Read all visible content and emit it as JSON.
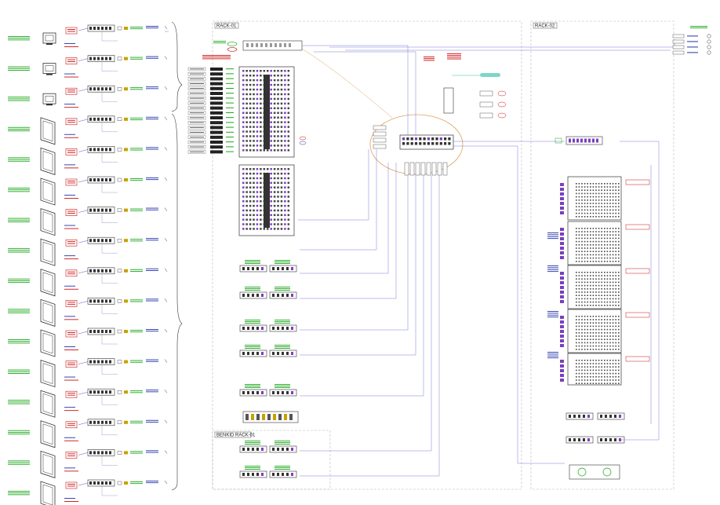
{
  "racks": {
    "rack1": "RACK-01",
    "rack2": "RACK-02",
    "benkid": "BENKID RACK-01"
  }
}
